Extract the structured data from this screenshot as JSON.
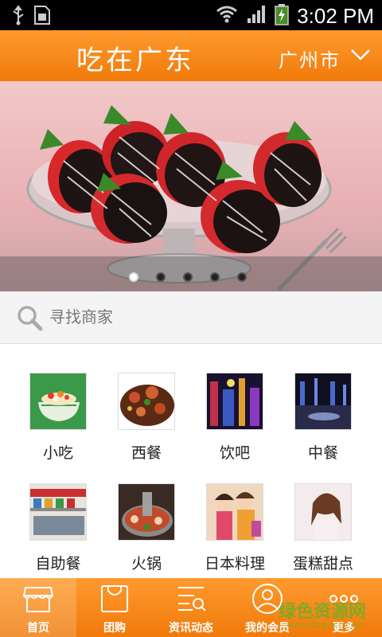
{
  "status_bar": {
    "time": "3:02 PM",
    "icons": [
      "usb-icon",
      "sim-icon",
      "wifi-icon",
      "signal-icon",
      "battery-charging-icon"
    ]
  },
  "header": {
    "title": "吃在广东",
    "city": "广州市"
  },
  "banner": {
    "slide_count": 5,
    "active_index": 0
  },
  "search": {
    "placeholder": "寻找商家"
  },
  "categories": [
    {
      "label": "小吃"
    },
    {
      "label": "西餐"
    },
    {
      "label": "饮吧"
    },
    {
      "label": "中餐"
    },
    {
      "label": "自助餐"
    },
    {
      "label": "火锅"
    },
    {
      "label": "日本料理"
    },
    {
      "label": "蛋糕甜点"
    }
  ],
  "tabs": [
    {
      "label": "首页",
      "icon": "store-icon",
      "active": true
    },
    {
      "label": "团购",
      "icon": "shopping-bag-icon"
    },
    {
      "label": "资讯动态",
      "icon": "news-search-icon"
    },
    {
      "label": "我的会员",
      "icon": "user-icon"
    },
    {
      "label": "更多",
      "icon": "more-icon"
    }
  ],
  "watermark": {
    "text": "绿色资源网",
    "url": "www.downcc.com"
  },
  "colors": {
    "brand_orange": "#f5830f",
    "status_bar": "#000000"
  }
}
